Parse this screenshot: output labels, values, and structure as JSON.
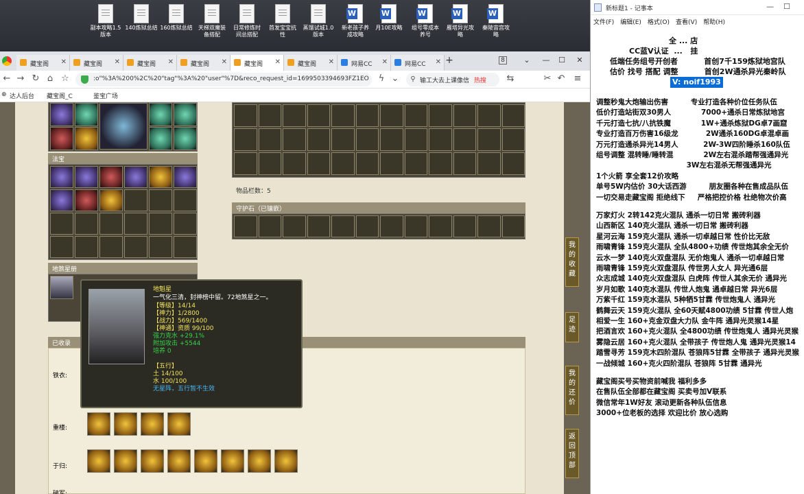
{
  "desktop": {
    "icons": [
      {
        "label": "副本攻略1.5\n版本",
        "kind": "doc"
      },
      {
        "label": "140炼狱总结",
        "kind": "doc"
      },
      {
        "label": "160炼狱总结",
        "kind": "doc"
      },
      {
        "label": "天梯双魔装\n备搭配",
        "kind": "doc"
      },
      {
        "label": "日常修炼时\n间总搭配",
        "kind": "doc"
      },
      {
        "label": "首发宝宝抗\n性",
        "kind": "doc"
      },
      {
        "label": "蒸馏试城1.0\n版本",
        "kind": "doc"
      },
      {
        "label": "新老孩子养\n成攻略",
        "kind": "word"
      },
      {
        "label": "月10E攻略",
        "kind": "word"
      },
      {
        "label": "组号零成本\n养号",
        "kind": "word"
      },
      {
        "label": "雁塔异光攻\n略",
        "kind": "word"
      },
      {
        "label": "秦陵宙宫攻\n略",
        "kind": "word"
      }
    ]
  },
  "browser": {
    "tabs": [
      {
        "label": "藏宝阁",
        "active": false
      },
      {
        "label": "藏宝阁",
        "active": false
      },
      {
        "label": "藏宝阁",
        "active": false
      },
      {
        "label": "藏宝阁",
        "active": false
      },
      {
        "label": "藏宝阁",
        "active": true
      },
      {
        "label": "藏宝阁",
        "active": false
      },
      {
        "label": "网易CC",
        "active": false
      },
      {
        "label": "网易CC",
        "active": false
      }
    ],
    "new_tab": "+",
    "tab_count_badge": "8",
    "url": ":o\"%3A%200%2C%20\"tag\"%3A%20\"user\"%7D&reco_request_id=1699503394693FZ1EO",
    "search_text": "输工大去上课像信",
    "search_hot": "热搜",
    "bookmarks": [
      "达人后台",
      "藏宝阁_C",
      "鉴宝广场"
    ]
  },
  "game": {
    "sections": {
      "fabao": "法宝",
      "dishazhuangtai": "地煞星册",
      "yishouji": "已收录",
      "item_count_label": "物品栏数：5",
      "guardian_stone": "守护石（已镶嵌）",
      "tieyi": "铁衣:",
      "chongluo": "重楼:",
      "yugui": "于归:",
      "pojun": "破军:"
    },
    "tooltip": {
      "name": "地魁星",
      "desc": "一气化三清，封神榜中留。72地煞星之一。",
      "level": "【等级】14/14",
      "shenli": "【神力】1/2800",
      "zhanli": "【战力】569/1400",
      "shentong": "【神通】资质   99/100",
      "strength": "强力克水 +29.1%",
      "attack": "附加攻击 +5544",
      "peiyang": "培养 0",
      "wuxing_title": "【五行】",
      "tu": "土 14/100",
      "shui": "水 100/100",
      "wuxing_note": "无星阵，五行暂不生效"
    },
    "side_buttons": [
      "我的收藏",
      "足迹",
      "我的还价",
      "返回顶部"
    ]
  },
  "notepad": {
    "title": "新标题1 - 记事本",
    "menu": [
      "文件(F)",
      "编辑(E)",
      "格式(O)",
      "查看(V)",
      "帮助(H)"
    ],
    "header_lines": [
      "全 ... 店",
      "CC蓝V认证  ...   挂",
      "低端任务组号开创者          首创7千159炼狱地宫队",
      "估价 找号 搭配 调整          首创2W通杀异光秦岭队"
    ],
    "vx": "V: noif1993",
    "lines": [
      "调整秒鬼大炮输出伤害         专业打造各种价位任务队伍",
      "低价打造站街双30男人            7000+通杀日常炼狱地宫",
      "千元打造七抗/八抗铁魔            1W+通杀炼狱DG卓7画窟",
      "专业打造百万伤害16级龙           2W通杀160DG卓混卓画",
      "万元打造通杀异光14男人          2W-3W四阶睡杀160队伍",
      "组号调整 混转睡/睡转混            2W左右混杀踏帮强通异光",
      "                                    3W左右混杀无帮强通异光",
      "1个火箭 享全套12价攻略",
      "单号5W内估价 30大话西游         朋友圈各种在售成品队伍",
      "一切交易走藏宝阁 拒绝线下     严格把控价格 杜绝物次价高",
      "",
      "万家灯火 2转142克火混队 通杀一切日常 搬砖利器",
      "山西新区 140克火混队 通杀一切日常 搬砖利器",
      "星河云海 159克火混队 通杀一切卓越日常 性价比无敌",
      "雨啸青锋 159克火混队 全队4800+功绩 传世炮其余全无价",
      "云水一梦 140克火双盘混队 无价炮鬼人 通杀一切卓越日常",
      "雨啸青锋 159克火双盘混队 传世男人女人 异光通6层",
      "众志成城 140克火双盘混队 白虎阵 传世人其余无价 通异光",
      "岁月如歌 140克水混队 传世人炮鬼 通卓越日常 异光6层",
      "万紫千红 159克水混队 5种牺5甘霖 传世炮鬼人 通异光",
      "鹤舞云天 159克火混队 全60天赋4800功绩 5甘霖 传世人炮",
      "相爱一生 160+克金双盘大力队 金牛阵 通异光灵猴14星",
      "把酒言欢 160+克火混队 全4800功绩 传世炮鬼人 通异光灵猴",
      "雾隐云居 160+克火混队 全带孩子 传世炮人鬼 通异光灵猴14",
      "踏雪寻芳 159克木四阶混队 苍狼阵5甘霖 全带孩子 通异光灵猴",
      "一战倾城 160+克火四阶混队 苍狼阵 5甘霖 通异光",
      "",
      "藏宝阁买号买物资前喊我 福利多多",
      "在售队伍全部都在藏宝阁 买卖号加V联系",
      "微信常年1W好友 滚动更新各种队伍信息",
      "3000+位老板的选择 欢迎比价 放心选购"
    ]
  }
}
